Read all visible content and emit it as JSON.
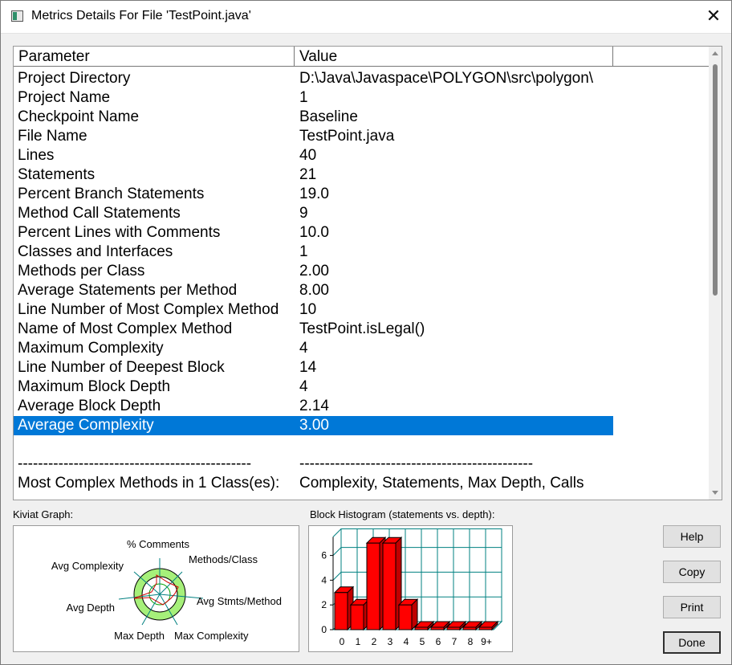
{
  "window": {
    "title": "Metrics Details For File 'TestPoint.java'",
    "close_glyph": "✕"
  },
  "table": {
    "columns": [
      "Parameter",
      "Value"
    ],
    "rows": [
      {
        "param": "Project Directory",
        "value": "D:\\Java\\Javaspace\\POLYGON\\src\\polygon\\"
      },
      {
        "param": "Project Name",
        "value": "1"
      },
      {
        "param": "Checkpoint Name",
        "value": "Baseline"
      },
      {
        "param": "File Name",
        "value": "TestPoint.java"
      },
      {
        "param": "Lines",
        "value": "40"
      },
      {
        "param": "Statements",
        "value": "21"
      },
      {
        "param": "Percent Branch Statements",
        "value": "19.0"
      },
      {
        "param": "Method Call Statements",
        "value": "9"
      },
      {
        "param": "Percent Lines with Comments",
        "value": "10.0"
      },
      {
        "param": "Classes and Interfaces",
        "value": "1"
      },
      {
        "param": "Methods per Class",
        "value": "2.00"
      },
      {
        "param": "Average Statements per Method",
        "value": "8.00"
      },
      {
        "param": "Line Number of Most Complex Method",
        "value": "10"
      },
      {
        "param": "Name of Most Complex Method",
        "value": "TestPoint.isLegal()"
      },
      {
        "param": "Maximum Complexity",
        "value": "4"
      },
      {
        "param": "Line Number of Deepest Block",
        "value": "14"
      },
      {
        "param": "Maximum Block Depth",
        "value": "4"
      },
      {
        "param": "Average Block Depth",
        "value": "2.14"
      },
      {
        "param": "Average Complexity",
        "value": "3.00",
        "selected": true
      }
    ],
    "separator": {
      "param": "----------------------------------------------",
      "value": "----------------------------------------------"
    },
    "footer": {
      "param": "Most Complex Methods in 1 Class(es):",
      "value": "Complexity, Statements, Max Depth, Calls"
    }
  },
  "kiviat": {
    "label": "Kiviat Graph:",
    "axes": [
      "% Comments",
      "Methods/Class",
      "Avg Stmts/Method",
      "Max Complexity",
      "Max Depth",
      "Avg Depth",
      "Avg Complexity"
    ]
  },
  "histogram": {
    "label": "Block Histogram (statements vs. depth):",
    "chart_data": {
      "type": "bar",
      "categories": [
        "0",
        "1",
        "2",
        "3",
        "4",
        "5",
        "6",
        "7",
        "8",
        "9+"
      ],
      "values": [
        3,
        2,
        7,
        7,
        2,
        0,
        0,
        0,
        0,
        0
      ],
      "yticks": [
        "0",
        "2",
        "4",
        "6"
      ],
      "ylim": [
        0,
        7.5
      ],
      "bar_color": "#ff0000"
    }
  },
  "buttons": {
    "help": "Help",
    "copy": "Copy",
    "print": "Print",
    "done": "Done"
  },
  "colors": {
    "selection": "#0078d7",
    "kiviat_fill": "#a6f07a",
    "grid": "#008080"
  }
}
